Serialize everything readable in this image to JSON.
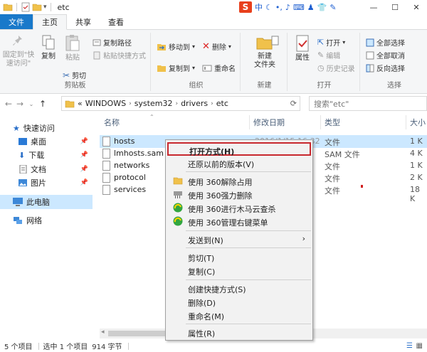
{
  "window": {
    "title": "etc",
    "ime_logo": "S",
    "ime_lang": "中",
    "controls": {
      "minimize": "—",
      "maximize": "☐",
      "close": "✕"
    }
  },
  "tabs": [
    "文件",
    "主页",
    "共享",
    "查看"
  ],
  "ribbon": {
    "clipboard": {
      "label": "剪贴板",
      "pin": "固定到\"快\n速访问\"",
      "copy": "复制",
      "paste": "粘贴",
      "copy_path": "复制路径",
      "paste_shortcut": "粘贴快捷方式",
      "cut": "剪切"
    },
    "organize": {
      "label": "组织",
      "move_to": "移动到",
      "copy_to": "复制到",
      "delete": "删除",
      "rename": "重命名"
    },
    "new": {
      "label": "新建",
      "new_folder": "新建\n文件夹"
    },
    "open": {
      "label": "打开",
      "properties": "属性",
      "open": "打开",
      "edit": "编辑",
      "history": "历史记录"
    },
    "select": {
      "label": "选择",
      "select_all": "全部选择",
      "select_none": "全部取消",
      "invert": "反向选择"
    }
  },
  "address": {
    "crumbs": [
      "«",
      "WINDOWS",
      "system32",
      "drivers",
      "etc"
    ],
    "search_placeholder": "搜索\"etc\""
  },
  "navpane": {
    "quick_access": "快速访问",
    "items": [
      "桌面",
      "下载",
      "文档",
      "图片"
    ],
    "this_pc": "此电脑",
    "network": "网络"
  },
  "columns": {
    "name": "名称",
    "date": "修改日期",
    "type": "类型",
    "size": "大小"
  },
  "files": [
    {
      "name": "hosts",
      "date": "2016/1/15 16:32",
      "type": "文件",
      "size": "1 K"
    },
    {
      "name": "lmhosts.sam",
      "date": "",
      "type": "SAM 文件",
      "size": "4 K"
    },
    {
      "name": "networks",
      "date": "",
      "type": "文件",
      "size": "1 K"
    },
    {
      "name": "protocol",
      "date": "",
      "type": "文件",
      "size": "2 K"
    },
    {
      "name": "services",
      "date": "",
      "type": "文件",
      "size": "18 K"
    }
  ],
  "context_menu": {
    "open_with": "打开方式(H)",
    "restore": "还原以前的版本(V)",
    "s360_unlock": "使用 360解除占用",
    "s360_delete": "使用 360强力删除",
    "s360_scan": "使用 360进行木马云查杀",
    "s360_manage": "使用 360管理右键菜单",
    "send_to": "发送到(N)",
    "cut": "剪切(T)",
    "copy": "复制(C)",
    "create_shortcut": "创建快捷方式(S)",
    "delete": "删除(D)",
    "rename": "重命名(M)",
    "properties": "属性(R)"
  },
  "status": {
    "count": "5 个项目",
    "selected": "选中 1 个项目",
    "size": "914 字节"
  },
  "colors": {
    "accent": "#1979ca",
    "selection": "#cce8ff",
    "highlight_border": "#c8282e"
  }
}
